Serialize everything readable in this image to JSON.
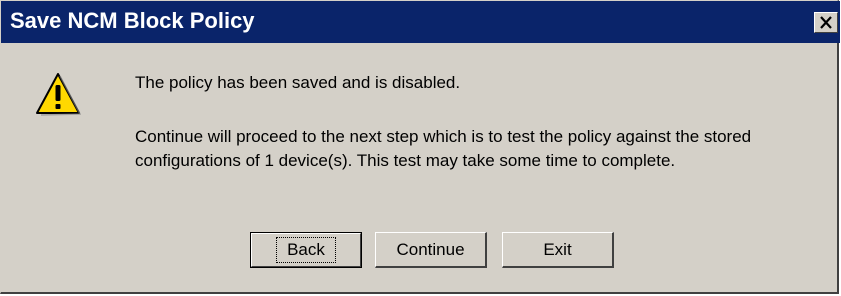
{
  "dialog": {
    "title": "Save NCM Block Policy",
    "close_glyph": "×",
    "message_line1": "The policy has been saved and is disabled.",
    "message_line2": "Continue will proceed to the next step which is to test the policy against the stored configurations of 1 device(s). This test may take some time to complete.",
    "icon": "warning-icon",
    "buttons": {
      "back": "Back",
      "continue": "Continue",
      "exit": "Exit"
    }
  },
  "colors": {
    "titlebar": "#0a246a",
    "dialog_bg": "#d4d0c8",
    "warning_yellow": "#ffd800"
  }
}
